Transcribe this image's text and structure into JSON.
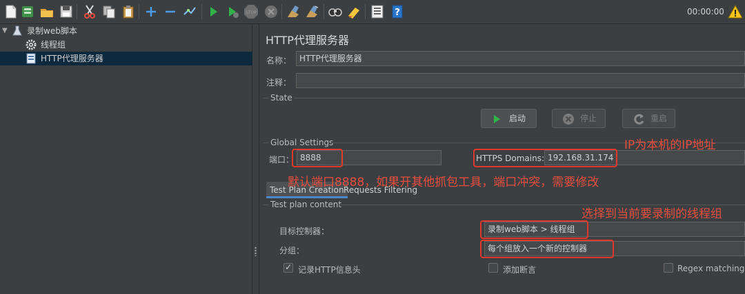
{
  "toolbar": {
    "timer": "00:00:00",
    "icons": [
      "new-icon",
      "templates-icon",
      "open-icon",
      "save-icon",
      "cut-icon",
      "copy-icon",
      "paste-icon",
      "expand-icon",
      "collapse-icon",
      "toggle-icon",
      "start-icon",
      "start-no-pause-icon",
      "stop-icon",
      "shutdown-icon",
      "clear-icon",
      "clear-all-icon",
      "search-icon",
      "reset-search-icon",
      "function-helper-icon",
      "help-icon",
      "warning-icon"
    ]
  },
  "tree": {
    "items": [
      {
        "label": "录制web脚本",
        "icon": "flask-icon"
      },
      {
        "label": "线程组",
        "icon": "gear-icon"
      },
      {
        "label": "HTTP代理服务器",
        "icon": "proxy-icon"
      }
    ]
  },
  "panel": {
    "title": "HTTP代理服务器",
    "name_label": "名称：",
    "name_value": "HTTP代理服务器",
    "comment_label": "注释：",
    "comment_value": "",
    "state_label": "State",
    "start_label": "启动",
    "stop_label": "停止",
    "restart_label": "重启",
    "global_label": "Global Settings",
    "port_label": "端口：",
    "port_value": "8888",
    "https_label": "HTTPS Domains:",
    "https_value": "192.168.31.174",
    "tabs": [
      "Test Plan Creation",
      "Requests Filtering"
    ],
    "content_label": "Test plan content",
    "target_label": "目标控制器：",
    "target_value": "录制web脚本 > 线程组",
    "group_label": "分组：",
    "group_value": "每个组放入一个新的控制器",
    "cb_headers_label": "记录HTTP信息头",
    "cb_assert_label": "添加断言",
    "cb_regex_label": "Regex matching",
    "cb_headers_checked": true,
    "cb_assert_checked": false,
    "cb_regex_checked": false
  },
  "annotations": {
    "ip_note": "IP为本机的IP地址",
    "port_note": "默认端口8888，如果开其他抓包工具，端口冲突，需要修改",
    "target_note": "选择到当前要录制的线程组",
    "color": "#e0392b"
  }
}
